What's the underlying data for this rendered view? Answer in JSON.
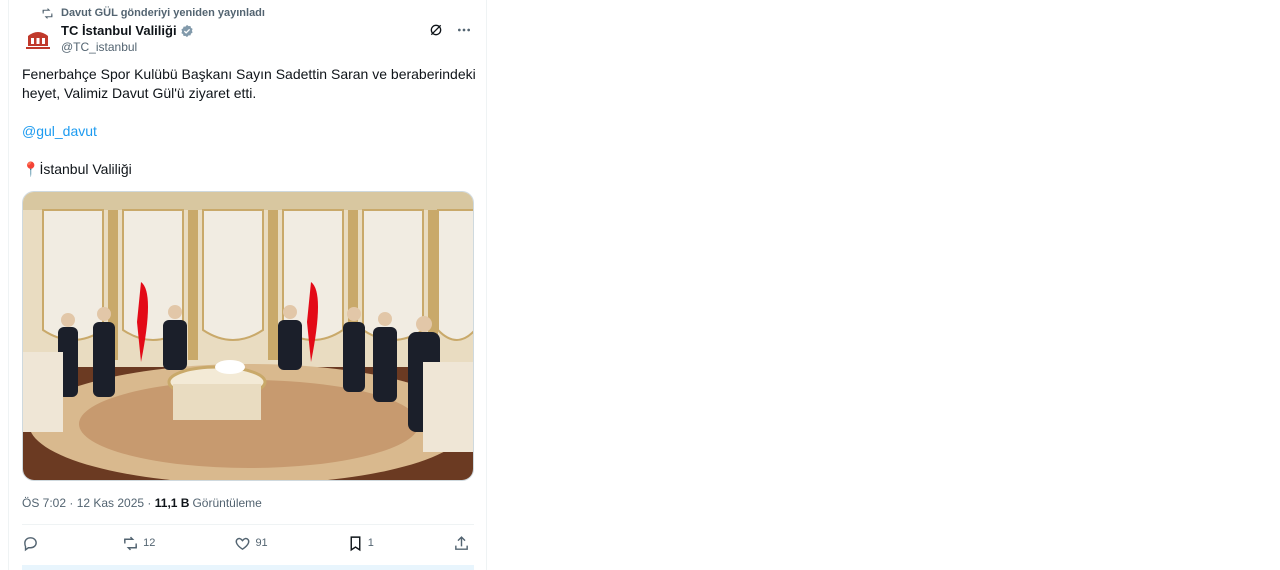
{
  "repost_banner": {
    "text": "Davut GÜL gönderiyi yeniden yayınladı",
    "icon": "repost-icon"
  },
  "author": {
    "name": "TC İstanbul Valiliği",
    "handle": "@TC_istanbul",
    "verified_icon": "verified-badge-icon",
    "verified_color": "#829aab"
  },
  "tweet": {
    "line1": "Fenerbahçe Spor Kulübü Başkanı Sayın Sadettin Saran ve beraberindeki heyet, Valimiz Davut Gül'ü ziyaret etti.",
    "mention": "@gul_davut",
    "location_pin": "📍",
    "location": "İstanbul Valiliği"
  },
  "meta": {
    "time": "ÖS 7:02 · 12 Kas 2025 · ",
    "views_count": "11,1 B",
    "views_label": "Görüntüleme"
  },
  "actions": {
    "replies": "",
    "reposts": "12",
    "likes": "91",
    "bookmarks": "1"
  },
  "colors": {
    "accent": "#1d9bf0",
    "muted": "#536471",
    "text": "#0f1419"
  }
}
